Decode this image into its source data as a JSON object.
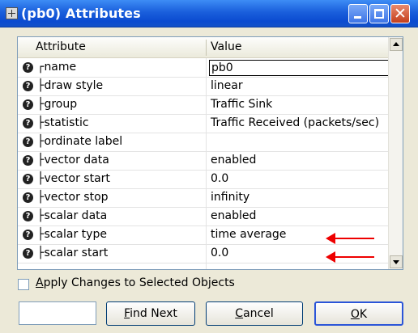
{
  "window": {
    "title": "(pb0) Attributes"
  },
  "table": {
    "headers": {
      "attribute": "Attribute",
      "value": "Value"
    },
    "rows": [
      {
        "prefix": "┌",
        "name": "name",
        "value": "pb0"
      },
      {
        "prefix": "├",
        "name": "draw style",
        "value": "linear"
      },
      {
        "prefix": "├",
        "name": "group",
        "value": "Traffic Sink"
      },
      {
        "prefix": "├",
        "name": "statistic",
        "value": "Traffic Received (packets/sec)"
      },
      {
        "prefix": "├",
        "name": "ordinate label",
        "value": ""
      },
      {
        "prefix": "├",
        "name": "vector data",
        "value": "enabled"
      },
      {
        "prefix": "├",
        "name": "vector start",
        "value": "0.0"
      },
      {
        "prefix": "├",
        "name": "vector stop",
        "value": "infinity"
      },
      {
        "prefix": "├",
        "name": "scalar data",
        "value": "enabled"
      },
      {
        "prefix": "├",
        "name": "scalar type",
        "value": "time average"
      },
      {
        "prefix": "├",
        "name": "scalar start",
        "value": "0.0"
      }
    ],
    "help_glyph": "?"
  },
  "apply_changes": {
    "label": "Apply Changes to Selected Objects",
    "checked": false
  },
  "buttons": {
    "find_next": "Find Next",
    "cancel": "Cancel",
    "ok": "OK"
  },
  "colors": {
    "annotation_arrow": "#e00000",
    "titlebar": "#0b4bd0"
  }
}
